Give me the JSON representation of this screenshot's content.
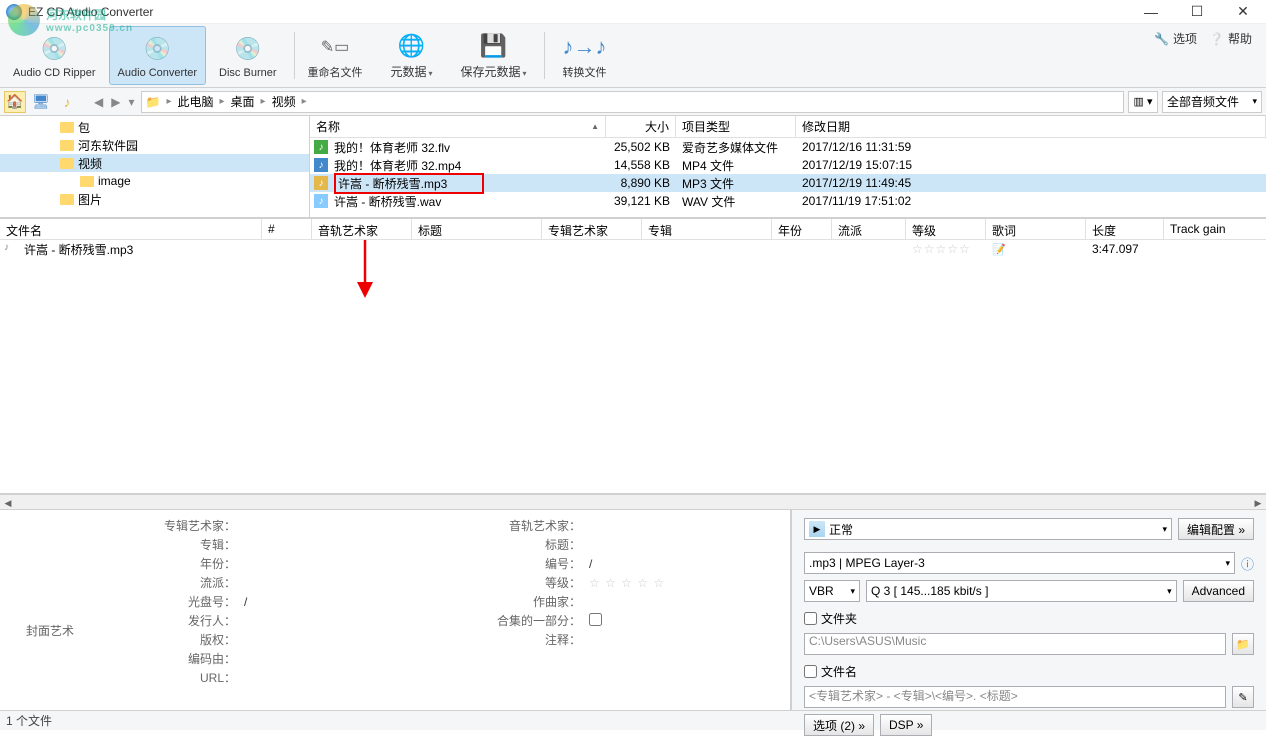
{
  "app": {
    "title": "EZ CD Audio Converter"
  },
  "watermark": {
    "text": "河东软件园",
    "url": "www.pc0359.cn"
  },
  "winbtns": {
    "min": "—",
    "max": "☐",
    "close": "✕"
  },
  "toolbar": {
    "ripper": "Audio CD Ripper",
    "converter": "Audio Converter",
    "burner": "Disc Burner",
    "rename": "重命名文件",
    "metadata": "元数据",
    "savemeta": "保存元数据",
    "convert": "转换文件",
    "options": "选项",
    "help": "帮助"
  },
  "breadcrumb": {
    "items": [
      "此电脑",
      "桌面",
      "视频"
    ],
    "filter": "全部音频文件"
  },
  "tree": [
    {
      "label": "包",
      "depth": 1,
      "sel": false
    },
    {
      "label": "河东软件园",
      "depth": 1,
      "sel": false
    },
    {
      "label": "视频",
      "depth": 1,
      "sel": true
    },
    {
      "label": "image",
      "depth": 2,
      "sel": false
    },
    {
      "label": "图片",
      "depth": 1,
      "sel": false
    }
  ],
  "file_cols": {
    "name": "名称",
    "size": "大小",
    "type": "项目类型",
    "date": "修改日期"
  },
  "files": [
    {
      "icon": "flv",
      "name": "我的！体育老师 32.flv",
      "size": "25,502 KB",
      "type": "爱奇艺多媒体文件",
      "date": "2017/12/16 11:31:59",
      "sel": false,
      "boxed": false
    },
    {
      "icon": "mp4",
      "name": "我的！体育老师 32.mp4",
      "size": "14,558 KB",
      "type": "MP4 文件",
      "date": "2017/12/19 15:07:15",
      "sel": false,
      "boxed": false
    },
    {
      "icon": "mp3",
      "name": "许嵩 - 断桥残雪.mp3",
      "size": "8,890 KB",
      "type": "MP3 文件",
      "date": "2017/12/19 11:49:45",
      "sel": true,
      "boxed": true
    },
    {
      "icon": "wav",
      "name": "许嵩 - 断桥残雪.wav",
      "size": "39,121 KB",
      "type": "WAV 文件",
      "date": "2017/11/19 17:51:02",
      "sel": false,
      "boxed": false
    }
  ],
  "queue_cols": {
    "file": "文件名",
    "idx": "#",
    "artist": "音轨艺术家",
    "title": "标题",
    "albumartist": "专辑艺术家",
    "album": "专辑",
    "year": "年份",
    "genre": "流派",
    "rating": "等级",
    "lyrics": "歌词",
    "length": "长度",
    "trackgain": "Track gain"
  },
  "queue": [
    {
      "file": "许嵩 - 断桥残雪.mp3",
      "idx": "",
      "artist": "",
      "title": "",
      "albumartist": "",
      "album": "",
      "year": "",
      "genre": "",
      "rating": "☆☆☆☆☆",
      "lyrics": "📝",
      "length": "3:47.097",
      "trackgain": ""
    }
  ],
  "meta": {
    "coverart": "封面艺术",
    "left": {
      "albumartist": "专辑艺术家：",
      "album": "专辑：",
      "year": "年份：",
      "genre": "流派：",
      "discno": "光盘号：",
      "discno_v": "/",
      "publisher": "发行人：",
      "copyright": "版权：",
      "encodedby": "编码由：",
      "url": "URL："
    },
    "right": {
      "artist": "音轨艺术家：",
      "title": "标题：",
      "trackno": "编号：",
      "trackno_v": "/",
      "rating": "等级：",
      "rating_v": "☆ ☆ ☆ ☆ ☆",
      "composer": "作曲家：",
      "compilation": "合集的一部分：",
      "comment": "注释："
    }
  },
  "output": {
    "preset": "正常",
    "editcfg": "编辑配置 »",
    "format": ".mp3 | MPEG Layer-3",
    "mode": "VBR",
    "quality": "Q 3  [ 145...185 kbit/s ]",
    "advanced": "Advanced",
    "folder_label": "文件夹",
    "folder": "C:\\Users\\ASUS\\Music",
    "filename_label": "文件名",
    "filename": "<专辑艺术家> - <专辑>\\<编号>. <标题>",
    "opts": "选项 (2) »",
    "dsp": "DSP »"
  },
  "status": {
    "text": "1 个文件"
  }
}
